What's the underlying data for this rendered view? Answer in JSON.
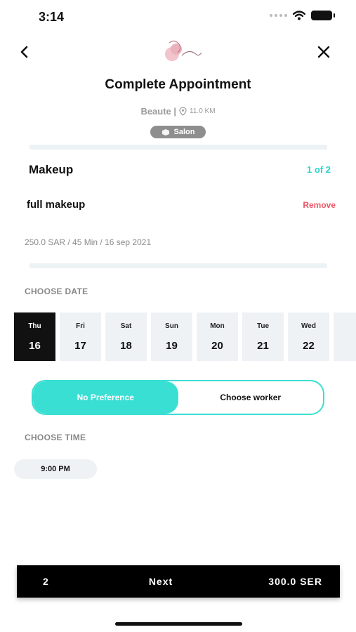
{
  "status": {
    "time": "3:14"
  },
  "header": {
    "title": "Complete Appointment",
    "brand": "Beaute |",
    "distance": "11.0 KM",
    "badge": "Salon"
  },
  "service": {
    "name": "Makeup",
    "count": "1 of 2",
    "item_name": "full makeup",
    "remove_label": "Remove",
    "details": "250.0 SAR / 45 Min / 16 sep 2021"
  },
  "date_section": {
    "label": "CHOOSE DATE",
    "dates": [
      {
        "dow": "Thu",
        "dom": "16",
        "selected": true
      },
      {
        "dow": "Fri",
        "dom": "17",
        "selected": false
      },
      {
        "dow": "Sat",
        "dom": "18",
        "selected": false
      },
      {
        "dow": "Sun",
        "dom": "19",
        "selected": false
      },
      {
        "dow": "Mon",
        "dom": "20",
        "selected": false
      },
      {
        "dow": "Tue",
        "dom": "21",
        "selected": false
      },
      {
        "dow": "Wed",
        "dom": "22",
        "selected": false
      },
      {
        "dow": "",
        "dom": "",
        "selected": false
      }
    ]
  },
  "worker_toggle": {
    "options": [
      "No Preference",
      "Choose worker"
    ],
    "selected": "No Preference"
  },
  "time_section": {
    "label": "CHOOSE TIME",
    "slots": [
      "9:00 PM"
    ]
  },
  "bottom_bar": {
    "count": "2",
    "next_label": "Next",
    "total": "300.0 SER"
  },
  "colors": {
    "accent": "#3adfd3",
    "accent_text": "#2ad4c6",
    "danger": "#ee5866",
    "selected_date": "#111111",
    "chip_bg": "#eef2f5"
  },
  "icons": {
    "back": "chevron-left-icon",
    "close": "close-icon",
    "location": "location-pin-icon",
    "salon": "salon-icon",
    "wifi": "wifi-icon",
    "battery": "battery-icon",
    "signal": "signal-icon"
  }
}
